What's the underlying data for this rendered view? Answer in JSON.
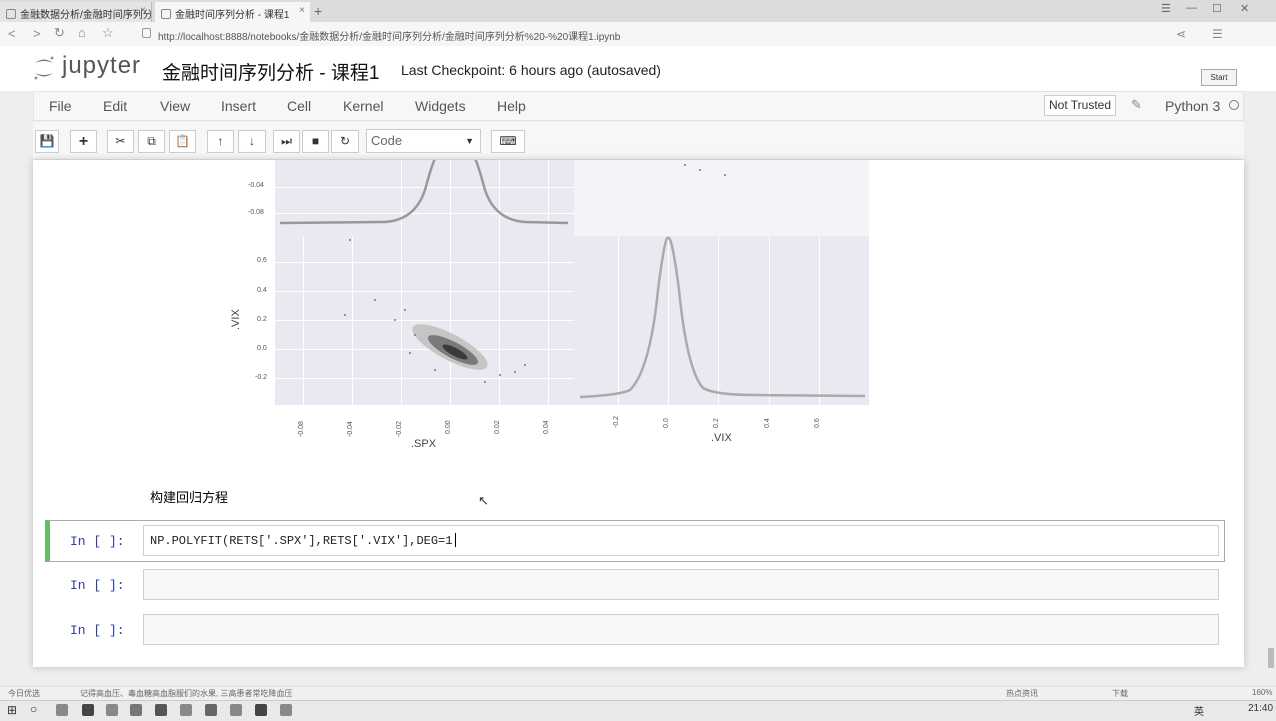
{
  "browser": {
    "tabs": [
      {
        "label": "金融数据分析/金融时间序列分析",
        "active": false
      },
      {
        "label": "金融时间序列分析 - 课程1",
        "active": true
      }
    ],
    "new_tab": "+",
    "url": "http://localhost:8888/notebooks/金融数据分析/金融时间序列分析/金融时间序列分析%20-%20课程1.ipynb"
  },
  "header": {
    "logo_text": "jupyter",
    "notebook_title": "金融时间序列分析 - 课程1",
    "checkpoint": "Last Checkpoint: 6 hours ago (autosaved)",
    "logout_label": "Start"
  },
  "menubar": {
    "items": [
      "File",
      "Edit",
      "View",
      "Insert",
      "Cell",
      "Kernel",
      "Widgets",
      "Help"
    ],
    "trusted": "Not Trusted",
    "kernel_name": "Python 3"
  },
  "toolbar": {
    "buttons": [
      "save-icon",
      "add-icon",
      "cut-icon",
      "copy-icon",
      "paste-icon",
      "move-up-icon",
      "move-down-icon",
      "run-icon",
      "stop-icon",
      "restart-icon",
      "keyboard-icon"
    ],
    "cell_type": "Code"
  },
  "plot": {
    "xlabel_left": ".SPX",
    "xlabel_right": ".VIX",
    "ylabel": ".VIX",
    "top_yticks": [
      "-0.04",
      "-0.08"
    ],
    "yticks": [
      "0.6",
      "0.4",
      "0.2",
      "0.0",
      "-0.2"
    ],
    "spx_xticks": [
      "-0.08",
      "-0.04",
      "-0.02",
      "0.00",
      "0.02",
      "0.04"
    ],
    "vix_xticks": [
      "-0.2",
      "0.0",
      "0.2",
      "0.4",
      "0.6"
    ]
  },
  "markdown_cell": "构建回归方程",
  "cells": [
    {
      "prompt": "In  [ ]:",
      "source": "NP.POLYFIT(RETS['.SPX'],RETS['.VIX'],DEG=1"
    },
    {
      "prompt": "In  [ ]:",
      "source": ""
    },
    {
      "prompt": "In  [ ]:",
      "source": ""
    }
  ],
  "statusbar": {
    "left_text": "今日优选",
    "news": "记得高血压、毒血糖高血脂服们的水果, 三高患者常吃降血压",
    "right_text": "热点资讯",
    "download": "下载",
    "zoom": "160%"
  },
  "taskbar": {
    "ime": "英",
    "time": "21:40"
  }
}
